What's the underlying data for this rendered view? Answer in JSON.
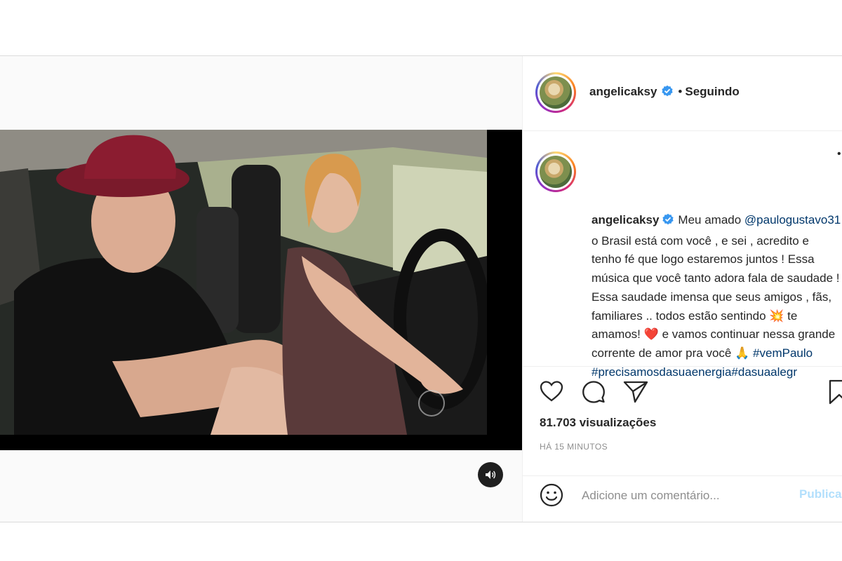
{
  "post": {
    "author": {
      "username": "angelicaksy",
      "verified": true,
      "follow_status": "Seguindo",
      "separator": "•"
    },
    "caption": {
      "username": "angelicaksy",
      "text_before_mention": "Meu amado",
      "mention": "@paulogustavo31",
      "text_after_mention": "o Brasil está com você , e sei , acredito e tenho fé que logo estaremos juntos ! Essa música que você tanto adora fala de saudade ! Essa saudade imensa que seus amigos , fãs, familiares .. todos estão sentindo",
      "emoji_sparkle": "💥",
      "text_love": "te amamos!",
      "emoji_heart": "❤️",
      "text_continue": "e vamos continuar nessa grande corrente de amor pra você",
      "emoji_pray": "🙏",
      "hashtag_1": "#vemPaulo",
      "hashtag_2": "#precisamosdasuaenergia",
      "hashtag_3": "#dasuaalegr"
    },
    "stats": {
      "views": "81.703 visualizações",
      "timestamp": "HÁ 15 MINUTOS"
    },
    "comment_box": {
      "placeholder": "Adicione um comentário...",
      "submit_label": "Publicar"
    },
    "icons": {
      "like": "heart-icon",
      "comment": "comment-icon",
      "share": "share-icon",
      "save": "bookmark-icon",
      "emoji": "smiley-icon",
      "mute": "speaker-icon",
      "more": "more-options-icon"
    },
    "colors": {
      "link": "#00376b",
      "verified": "#3897f0",
      "secondary_text": "#8e8e8e",
      "publish_disabled": "#b2dffc"
    }
  }
}
